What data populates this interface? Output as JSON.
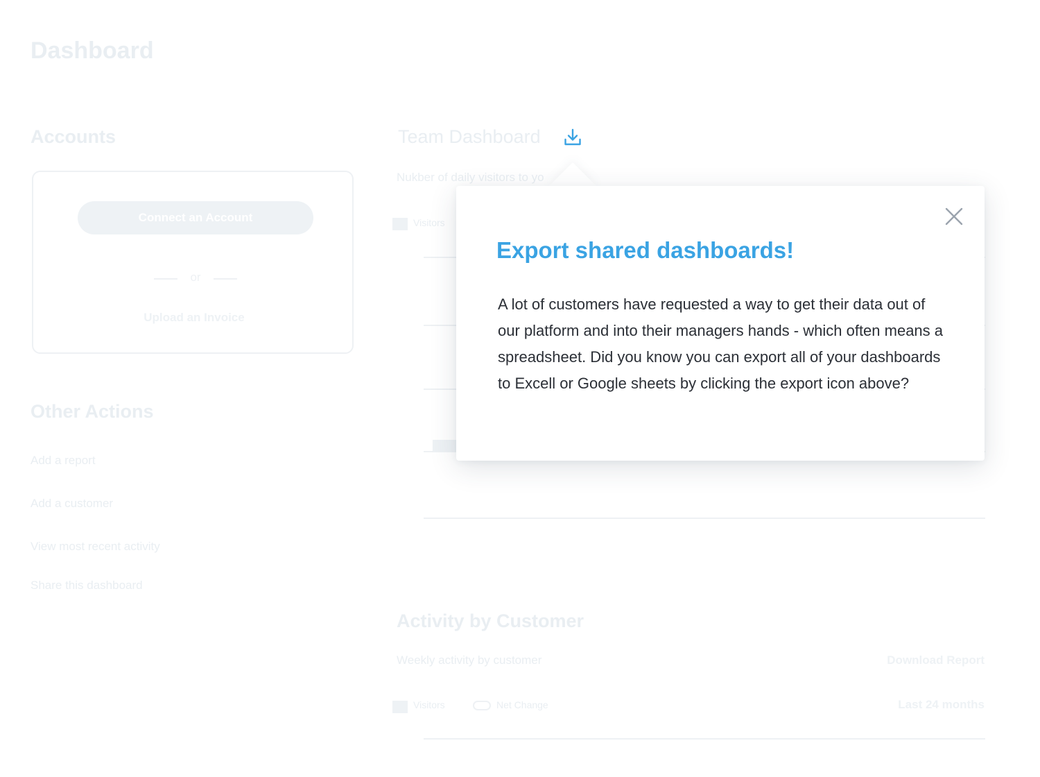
{
  "page": {
    "title": "Dashboard"
  },
  "accounts": {
    "heading": "Accounts",
    "connect_label": "Connect an Account",
    "or_label": "or",
    "upload_label": "Upload an Invoice"
  },
  "other_actions": {
    "heading": "Other Actions",
    "items": [
      {
        "label": "Add a report"
      },
      {
        "label": "Add a customer"
      },
      {
        "label": "View most recent activity"
      },
      {
        "label": "Share this dashboard"
      }
    ]
  },
  "team_dashboard": {
    "heading": "Team Dashboard",
    "subtitle": "Nukber of daily visitors to yo",
    "legend_visitors": "Visitors",
    "export_icon": "download-icon"
  },
  "activity": {
    "heading": "Activity by Customer",
    "subtitle": "Weekly activity by customer",
    "download_label": "Download Report",
    "legend_visitors": "Visitors",
    "legend_net_change": "Net Change",
    "range_label": "Last 24 months"
  },
  "popover": {
    "title": "Export shared dashboards!",
    "body": "A lot of customers have requested a way to get their data out of our platform and into their managers hands - which often means a spreadsheet. Did you know you can export all of your dashboards to Excell or Google sheets by clicking the export icon above?",
    "close_icon": "close-icon"
  },
  "colors": {
    "accent": "#3aa3e3",
    "faint": "#e9eef2",
    "text": "#2b2f36"
  }
}
